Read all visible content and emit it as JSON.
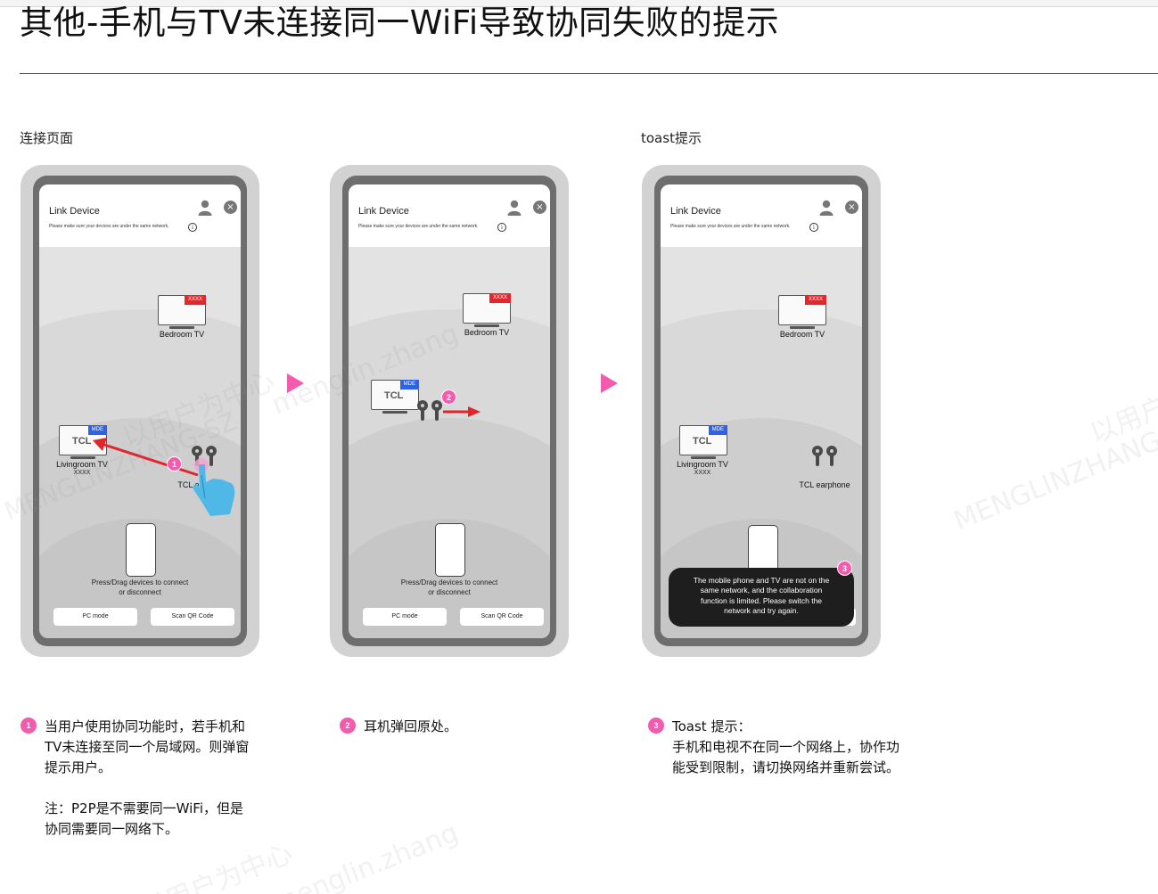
{
  "page": {
    "title": "其他-手机与TV未连接同一WiFi导致协同失败的提示"
  },
  "sections": {
    "connect": "连接页面",
    "toast": "toast提示"
  },
  "phone_ui": {
    "title": "Link Device",
    "subtitle": "Please make sure your devices are under the same network.",
    "info_glyph": "i",
    "close_glyph": "×",
    "bedroom_tv": "Bedroom TV",
    "bedroom_badge": "XXXX",
    "living_tv": "Livingroom TV",
    "living_sub": "XXXX",
    "living_badge": "MDE",
    "tv_logo": "TCL",
    "earphone": "TCL earphone",
    "hint_line1": "Press/Drag devices to connect",
    "hint_line2": "or disconnect",
    "pc_mode": "PC mode",
    "scan_qr": "Scan QR Code"
  },
  "toast": {
    "line1": "The mobile phone and TV are not on the",
    "line2": "same network, and the collaboration",
    "line3": "function is limited. Please switch the",
    "line4": "network and try again."
  },
  "steps": {
    "s1": "1",
    "s2": "2",
    "s3": "3"
  },
  "notes": {
    "n1_line1": "当用户使用协同功能时，若手机和",
    "n1_line2": "TV未连接至同一个局域网。则弹窗",
    "n1_line3": "提示用户。",
    "n1_line4": "注：P2P是不需要同一WiFi，但是",
    "n1_line5": "协同需要同一网络下。",
    "n2_line1": "耳机弹回原处。",
    "n3_line1": "Toast 提示：",
    "n3_line2": "手机和电视不在同一个网络上，协作功",
    "n3_line3": "能受到限制，请切换网络并重新尝试。"
  },
  "watermarks": {
    "w1": "以用户为中心",
    "w2": "menglin.zhang",
    "w3": "MENGLINZHANG-SZ",
    "w4": "以用户为中心",
    "w5": "MENGLINZHANG"
  },
  "colors": {
    "accent_pink": "#f25bae",
    "badge_red": "#e6262b",
    "badge_blue": "#2f63e6",
    "drag_arrow": "#e0262b",
    "toast_bg": "#1e1e1e"
  }
}
